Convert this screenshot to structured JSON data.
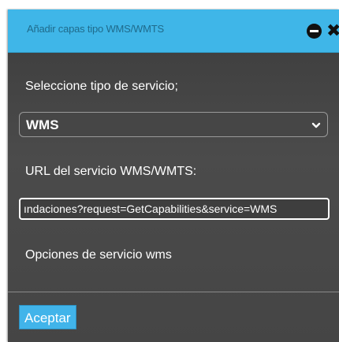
{
  "dialog": {
    "title": "Añadir capas tipo WMS/WMTS",
    "service_type_label": "Seleccione tipo de servicio;",
    "service_type_selected": "WMS",
    "url_label": "URL del servicio WMS/WMTS:",
    "url_value": "ındaciones?request=GetCapabilities&service=WMS",
    "options_label": "Opciones de servicio wms",
    "accept_label": "Aceptar"
  },
  "icons": {
    "minimize": "minimize-icon",
    "close": "close-icon",
    "select_arrow": "chevron-down-icon"
  },
  "colors": {
    "titlebar": "#3fb6e8",
    "body": "#454545",
    "accent_button": "#41b4ea"
  }
}
